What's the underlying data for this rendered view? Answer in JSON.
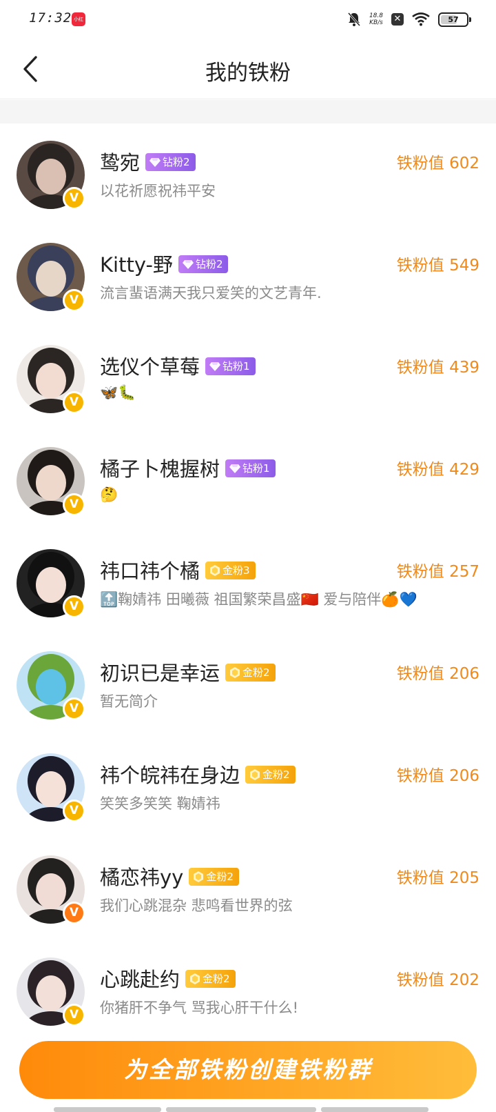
{
  "status": {
    "time": "17:32",
    "app_badge": "小红书",
    "net_speed_value": "18.8",
    "net_speed_unit": "KB/s",
    "battery": "57"
  },
  "nav": {
    "title": "我的铁粉"
  },
  "fans": [
    {
      "name": "鸷宛",
      "badge": "钻粉2",
      "badge_type": "diamond",
      "bio": "以花祈愿祝祎平安",
      "score": "铁粉值 602",
      "avatar_colors": [
        "#5a4a44",
        "#d9c0b2",
        "#2a2522"
      ]
    },
    {
      "name": "Kitty-野",
      "badge": "钻粉2",
      "badge_type": "diamond",
      "bio": "流言蜚语满天我只爱笑的文艺青年.",
      "score": "铁粉值 549",
      "avatar_colors": [
        "#6d5a4a",
        "#e6d6c8",
        "#3a3f5a"
      ]
    },
    {
      "name": "选仪个草莓",
      "badge": "钻粉1",
      "badge_type": "diamond",
      "bio": "🦋🐛",
      "score": "铁粉值 439",
      "avatar_colors": [
        "#efe9e6",
        "#f2dcd2",
        "#2b2524"
      ]
    },
    {
      "name": "橘子卜槐握树",
      "badge": "钻粉1",
      "badge_type": "diamond",
      "bio": "🤔",
      "score": "铁粉值 429",
      "avatar_colors": [
        "#c9c4bf",
        "#eed8cc",
        "#1f1a18"
      ]
    },
    {
      "name": "祎口祎个橘",
      "badge": "金粉3",
      "badge_type": "gold",
      "bio": "🔝鞠婧祎 田曦薇 祖国繁荣昌盛🇨🇳 爱与陪伴🍊💙",
      "score": "铁粉值 257",
      "avatar_colors": [
        "#222222",
        "#f4dfd6",
        "#111111"
      ]
    },
    {
      "name": "初识已是幸运",
      "badge": "金粉2",
      "badge_type": "gold",
      "bio": "暂无简介",
      "score": "铁粉值 206",
      "avatar_colors": [
        "#bfe3f4",
        "#5ec2e6",
        "#6aa63a"
      ]
    },
    {
      "name": "祎个皖祎在身边",
      "badge": "金粉2",
      "badge_type": "gold",
      "bio": "笑笑多笑笑 鞠婧祎",
      "score": "铁粉值 206",
      "avatar_colors": [
        "#cfe4f7",
        "#f6e1d9",
        "#1c1c2a"
      ]
    },
    {
      "name": "橘恋祎yy",
      "badge": "金粉2",
      "badge_type": "gold",
      "bio": "我们心跳混杂 悲鸣看世界的弦",
      "score": "铁粉值 205",
      "avatar_colors": [
        "#e9e1de",
        "#f0dcd5",
        "#232020"
      ],
      "badge_orange": true
    },
    {
      "name": "心跳赴约",
      "badge": "金粉2",
      "badge_type": "gold",
      "bio": "你猪肝不争气 骂我心肝干什么!",
      "score": "铁粉值 202",
      "avatar_colors": [
        "#e6e6ea",
        "#f1dfd8",
        "#2a2226"
      ]
    }
  ],
  "bottom": {
    "button_label": "为全部铁粉创建铁粉群"
  }
}
